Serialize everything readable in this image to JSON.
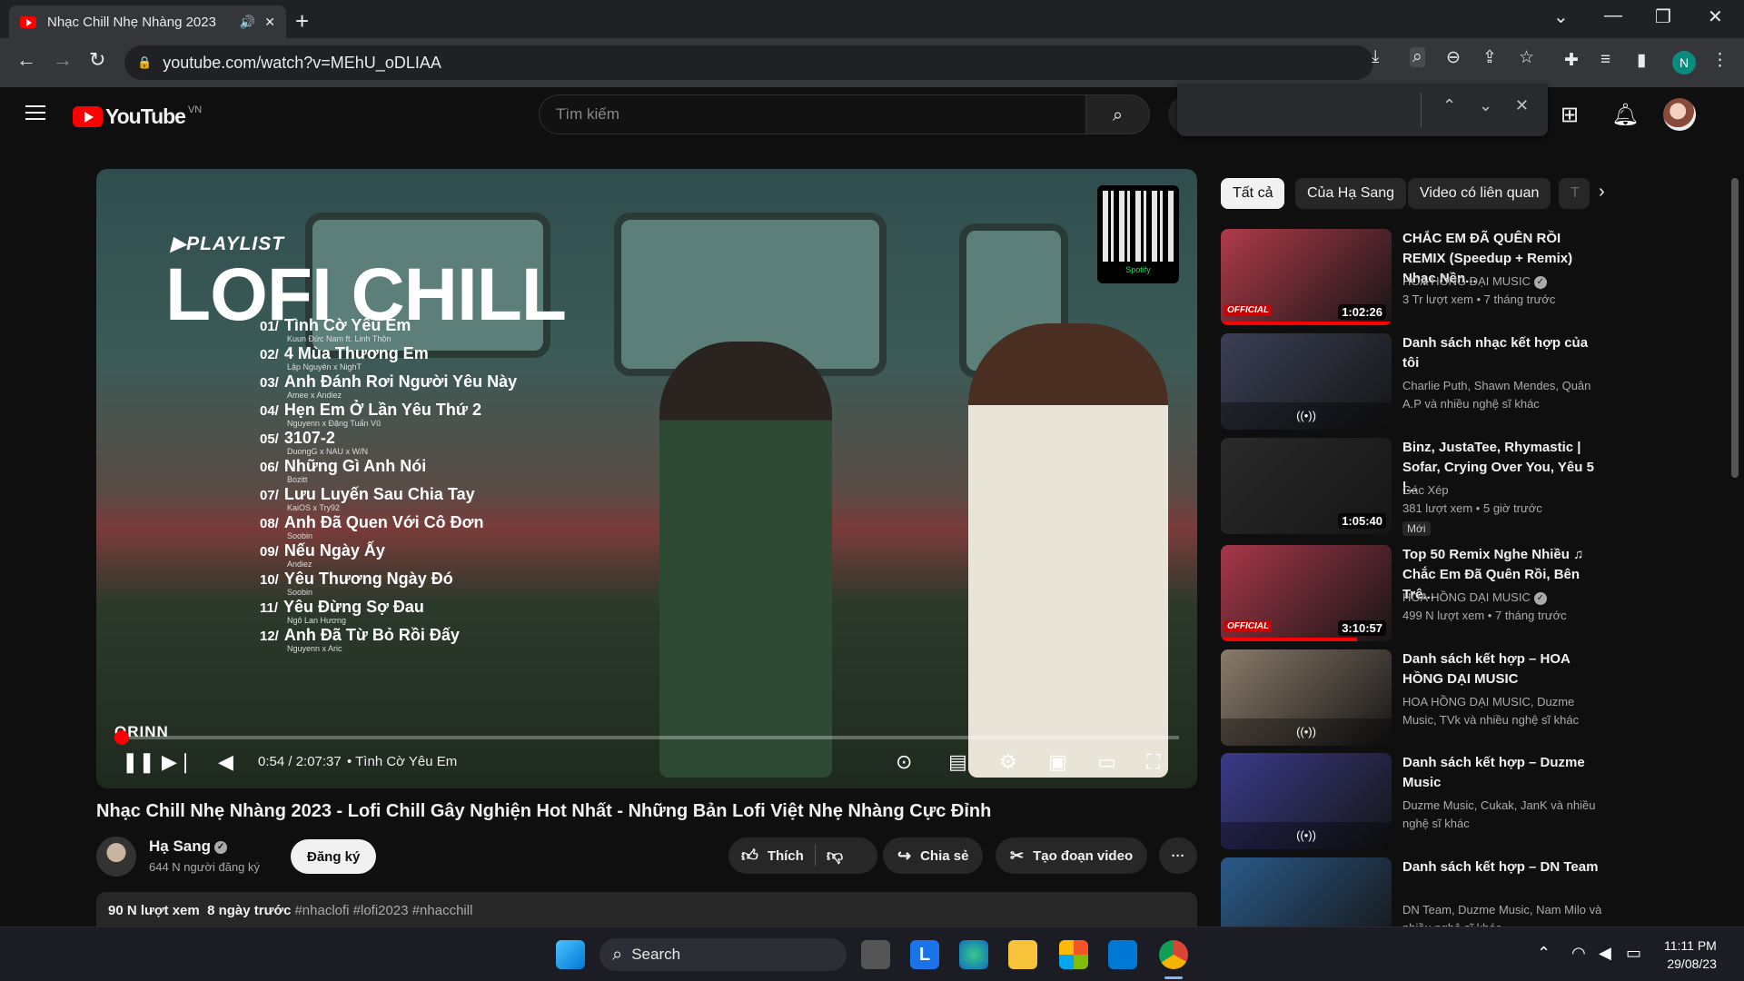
{
  "browser": {
    "tab_title": "Nhạc Chill Nhẹ Nhàng 2023",
    "url": "youtube.com/watch?v=MEhU_oDLIAA",
    "profile_initial": "N"
  },
  "header": {
    "logo_text": "YouTube",
    "country": "VN",
    "search_placeholder": "Tìm kiếm"
  },
  "player": {
    "overlay_tag": "▶PLAYLIST",
    "overlay_title": "LOFI CHILL",
    "qr_label": "Spotify",
    "brand": "ORINN",
    "time": "0:54 / 2:07:37",
    "chapter": "• Tình Cờ Yêu Em",
    "progress_fraction": 0.007,
    "tracks": [
      {
        "n": "01/",
        "title": "Tình Cờ Yêu Em",
        "artist": "Kuun Đức Nam ft. Linh Thộn"
      },
      {
        "n": "02/",
        "title": "4 Mùa Thương Em",
        "artist": "Lập Nguyên x NighT"
      },
      {
        "n": "03/",
        "title": "Anh Đánh Rơi Người Yêu Này",
        "artist": "Amee x Andiez"
      },
      {
        "n": "04/",
        "title": "Hẹn Em Ở Lần Yêu Thứ 2",
        "artist": "Nguyenn x Đặng Tuấn Vũ"
      },
      {
        "n": "05/",
        "title": "3107-2",
        "artist": "DuongG x NAU x W/N"
      },
      {
        "n": "06/",
        "title": "Những Gì Anh Nói",
        "artist": "Bozitt"
      },
      {
        "n": "07/",
        "title": "Lưu Luyến Sau Chia Tay",
        "artist": "KaiOS x Try92"
      },
      {
        "n": "08/",
        "title": "Anh Đã Quen Với Cô Đơn",
        "artist": "Soobin"
      },
      {
        "n": "09/",
        "title": "Nếu Ngày Ấy",
        "artist": "Andiez"
      },
      {
        "n": "10/",
        "title": "Yêu Thương Ngày Đó",
        "artist": "Soobin"
      },
      {
        "n": "11/",
        "title": "Yêu Đừng Sợ Đau",
        "artist": "Ngô Lan Hương"
      },
      {
        "n": "12/",
        "title": "Anh Đã Từ Bỏ Rồi Đấy",
        "artist": "Nguyenn x Aric"
      }
    ]
  },
  "video": {
    "title": "Nhạc Chill Nhẹ Nhàng 2023 - Lofi Chill Gây Nghiện Hot Nhất - Những Bản Lofi Việt Nhẹ Nhàng Cực Đỉnh",
    "channel": "Hạ Sang",
    "subs": "644 N người đăng ký",
    "subscribe": "Đăng ký",
    "like": "Thích",
    "share": "Chia sẻ",
    "clip": "Tạo đoạn video",
    "more": "···",
    "views_date": "90 N lượt xem  8 ngày trước",
    "hashtags": "#nhaclofi #lofi2023 #nhacchill"
  },
  "chips": [
    "Tất cả",
    "Của Hạ Sang",
    "Video có liên quan",
    "T"
  ],
  "recommendations": [
    {
      "title": "CHẮC EM ĐÃ QUÊN RỒI REMIX (Speedup + Remix) Nhạc Nền...",
      "channel": "HOA HỒNG DẠI MUSIC",
      "meta": "3 Tr lượt xem  • 7 tháng trước",
      "duration": "1:02:26",
      "verified": true,
      "badge": "OFFICIAL",
      "thumb_color": "#b03a4a"
    },
    {
      "title": "Danh sách nhạc kết hợp của tôi",
      "channel": "Charlie Puth, Shawn Mendes, Quân A.P và nhiều nghệ sĩ khác",
      "meta": "",
      "mix": "((•))",
      "thumb_color": "#3a3f55"
    },
    {
      "title": "Binz, JustaTee, Rhymastic | Sofar, Crying Over You, Yêu 5 |...",
      "channel": "Gác Xép",
      "meta": "381 lượt xem  • 5 giờ trước",
      "duration": "1:05:40",
      "new": "Mới",
      "thumb_color": "#2a2a2a"
    },
    {
      "title": "Top 50 Remix Nghe Nhiều ♫ Chắc Em Đã Quên Rồi, Bên Trê...",
      "channel": "HOA HỒNG DẠI MUSIC",
      "meta": "499 N lượt xem  • 7 tháng trước",
      "duration": "3:10:57",
      "verified": true,
      "badge": "OFFICIAL",
      "thumb_color": "#a8374a"
    },
    {
      "title": "Danh sách kết hợp – HOA HỒNG DẠI MUSIC",
      "channel": "HOA HỒNG DẠI MUSIC, Duzme Music, TVk và nhiều nghệ sĩ khác",
      "meta": "",
      "mix": "((•))",
      "thumb_color": "#8a7a6a"
    },
    {
      "title": "Danh sách kết hợp – Duzme Music",
      "channel": "Duzme Music, Cukak, JanK và nhiều nghệ sĩ khác",
      "meta": "",
      "mix": "((•))",
      "thumb_color": "#3a3a8a"
    },
    {
      "title": "Danh sách kết hợp – DN Team",
      "channel": "DN Team, Duzme Music, Nam Milo và nhiều nghệ sĩ khác",
      "meta": "",
      "thumb_color": "#2a5a8a"
    }
  ],
  "taskbar": {
    "search": "Search",
    "time": "11:11 PM",
    "date": "29/08/23"
  }
}
